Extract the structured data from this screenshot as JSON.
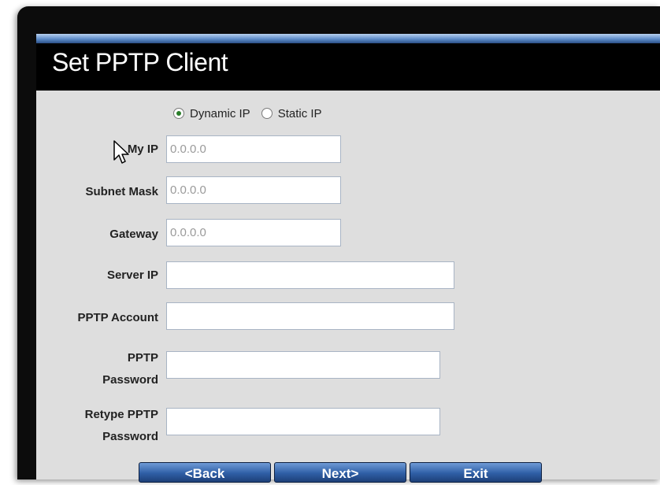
{
  "window": {
    "title": "Set PPTP Client"
  },
  "mode": {
    "options": [
      {
        "label": "Dynamic IP",
        "selected": true
      },
      {
        "label": "Static IP",
        "selected": false
      }
    ]
  },
  "fields": {
    "my_ip": {
      "label": "My IP",
      "value": "0.0.0.0"
    },
    "subnet_mask": {
      "label": "Subnet Mask",
      "value": "0.0.0.0"
    },
    "gateway": {
      "label": "Gateway",
      "value": "0.0.0.0"
    },
    "server_ip": {
      "label": "Server IP",
      "value": ""
    },
    "pptp_account": {
      "label": "PPTP Account",
      "value": ""
    },
    "pptp_password": {
      "label_line1": "PPTP",
      "label_line2": "Password",
      "value": ""
    },
    "retype_password": {
      "label_line1": "Retype PPTP",
      "label_line2": "Password",
      "value": ""
    }
  },
  "buttons": {
    "back": "<Back",
    "next": "Next>",
    "exit": "Exit"
  },
  "colors": {
    "accent": "#2f5fa6",
    "panel": "#dedede",
    "selected_radio": "#2a7d2a"
  }
}
